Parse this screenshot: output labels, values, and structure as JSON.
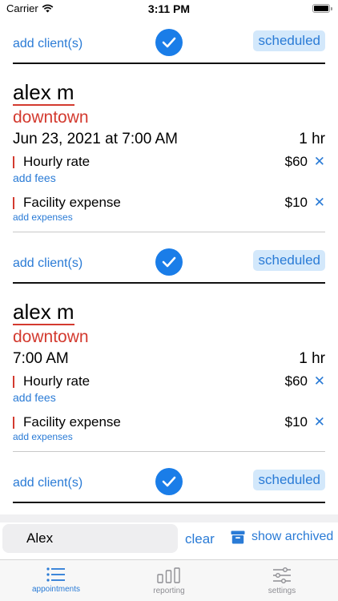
{
  "status_bar": {
    "carrier": "Carrier",
    "time": "3:11 PM"
  },
  "colors": {
    "accent": "#2a7bd6",
    "location_red": "#d33a2f",
    "badge_bg": "#d3e8fb"
  },
  "toolbar": {
    "add_client_label": "add client(s)",
    "status_label": "scheduled"
  },
  "appointments": [
    {
      "client": "alex m",
      "location": "downtown",
      "datetime": "Jun 23, 2021 at 7:00 AM",
      "duration": "1 hr",
      "fee": {
        "label": "Hourly rate",
        "amount": "$60"
      },
      "add_fees_label": "add fees",
      "expense": {
        "label": "Facility expense",
        "amount": "$10"
      },
      "add_expenses_label": "add expenses"
    },
    {
      "client": "alex m",
      "location": "downtown",
      "datetime": "7:00 AM",
      "duration": "1 hr",
      "fee": {
        "label": "Hourly rate",
        "amount": "$60"
      },
      "add_fees_label": "add fees",
      "expense": {
        "label": "Facility expense",
        "amount": "$10"
      },
      "add_expenses_label": "add expenses"
    }
  ],
  "remove_symbol": "✕",
  "search": {
    "value": "Alex",
    "clear_label": "clear",
    "archive_label": "show archived"
  },
  "tabs": [
    {
      "label": "appointments",
      "icon": "list-icon",
      "active": true
    },
    {
      "label": "reporting",
      "icon": "bar-chart-icon",
      "active": false
    },
    {
      "label": "settings",
      "icon": "sliders-icon",
      "active": false
    }
  ]
}
